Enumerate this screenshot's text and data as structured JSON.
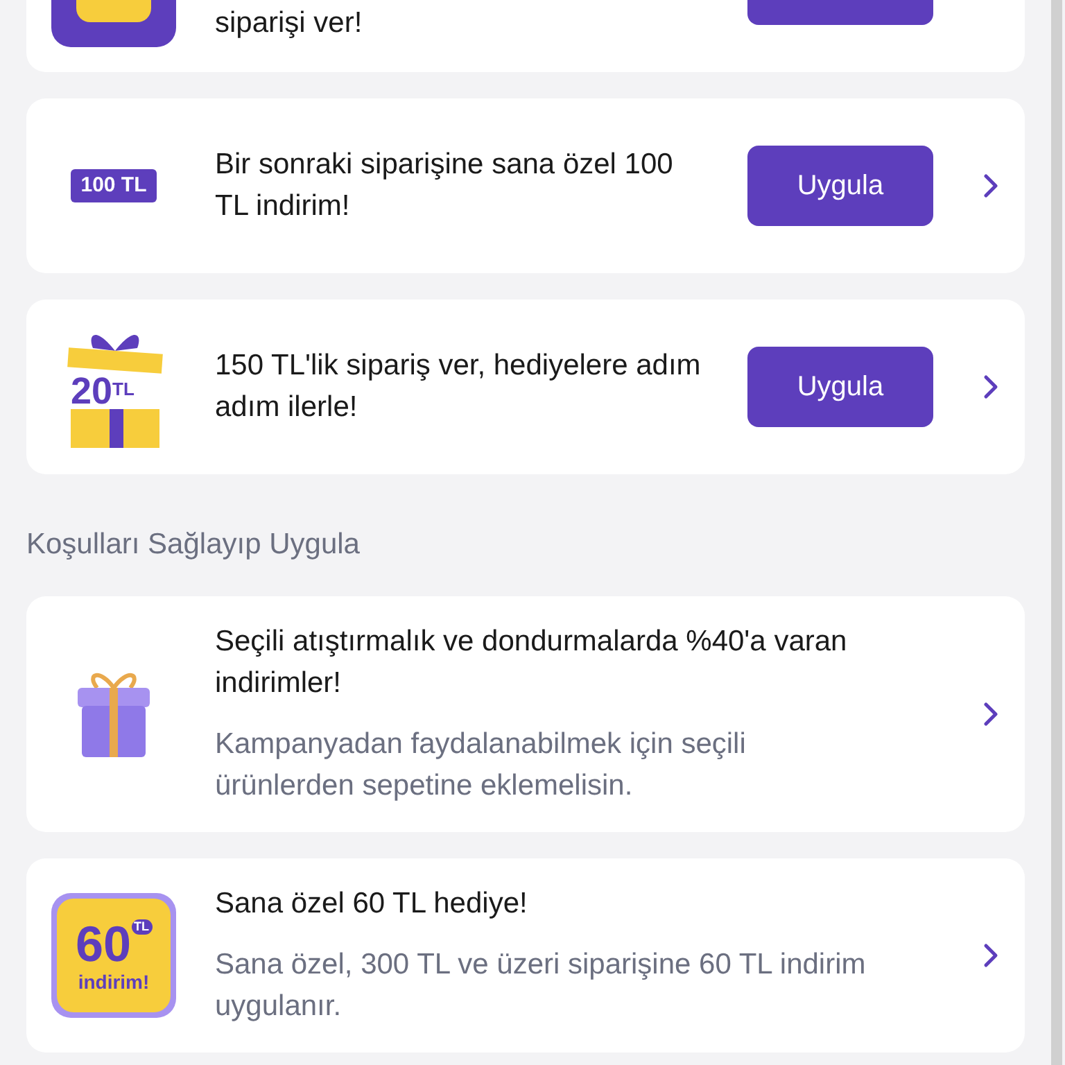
{
  "offers": [
    {
      "kind": "top",
      "title": "siparişi ver!"
    },
    {
      "kind": "tag",
      "tag": "100 TL",
      "title": "Bir sonraki siparişine sana özel 100 TL indirim!",
      "button": "Uygula"
    },
    {
      "kind": "gift20",
      "amount": "20",
      "unit": "TL",
      "title": "150 TL'lik sipariş ver, hediyelere adım adım ilerle!",
      "button": "Uygula"
    }
  ],
  "section_title": "Koşulları Sağlayıp Uygula",
  "conditional_offers": [
    {
      "kind": "gift",
      "title": "Seçili atıştırmalık ve dondurmalarda %40'a varan indirimler!",
      "description": "Kampanyadan faydalanabilmek için seçili ürünlerden sepetine eklemelisin."
    },
    {
      "kind": "badge60",
      "amount": "60",
      "unit": "TL",
      "caption": "indirim!",
      "title": "Sana özel 60 TL hediye!",
      "description": "Sana özel, 300 TL ve üzeri siparişine 60 TL indirim uygulanır."
    }
  ]
}
